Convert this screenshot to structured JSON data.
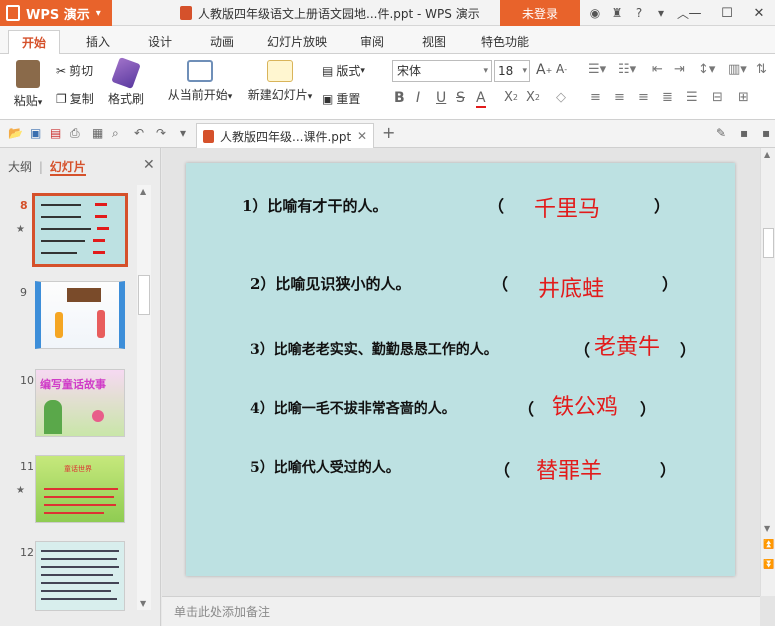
{
  "app": {
    "name": "WPS 演示"
  },
  "window": {
    "title": "人教版四年级语文上册语文园地...件.ppt - WPS 演示",
    "login_label": "未登录",
    "help_label": "?"
  },
  "menu": {
    "tabs": [
      "开始",
      "插入",
      "设计",
      "动画",
      "幻灯片放映",
      "审阅",
      "视图",
      "特色功能"
    ]
  },
  "ribbon": {
    "paste": "粘贴",
    "cut": "剪切",
    "copy": "复制",
    "format_painter": "格式刷",
    "play_from_current": "从当前开始",
    "new_slide": "新建幻灯片",
    "layout": "版式",
    "reset": "重置",
    "font": "宋体",
    "font_size": "18"
  },
  "doc_tab": {
    "title": "人教版四年级...课件.ppt"
  },
  "left_panel": {
    "outline_tab": "大纲",
    "slides_tab": "幻灯片",
    "slides": [
      {
        "num": "8"
      },
      {
        "num": "9"
      },
      {
        "num": "10",
        "caption": "编写童话故事"
      },
      {
        "num": "11",
        "caption": "童话世界"
      },
      {
        "num": "12"
      }
    ]
  },
  "slide": {
    "items": [
      {
        "question": "1）比喻有才干的人。",
        "answer": "千里马"
      },
      {
        "question": "2）比喻见识狭小的人。",
        "answer": "井底蛙"
      },
      {
        "question": "3）比喻老老实实、勤勤恳恳工作的人。",
        "answer": "老黄牛"
      },
      {
        "question": "4）比喻一毛不拔非常吝啬的人。",
        "answer": "铁公鸡"
      },
      {
        "question": "5）比喻代人受过的人。",
        "answer": "替罪羊"
      }
    ],
    "paren_open": "（",
    "paren_close": "）"
  },
  "notes": {
    "placeholder": "单击此处添加备注"
  },
  "colors": {
    "accent": "#e8632b",
    "slide_bg": "#bde1e2",
    "answer": "#e21b1b"
  }
}
